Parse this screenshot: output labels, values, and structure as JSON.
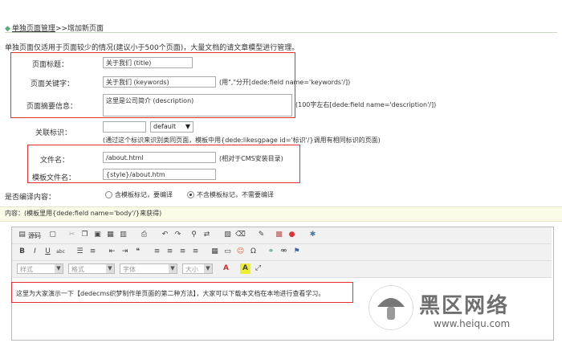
{
  "breadcrumb": {
    "section": "单独页面管理",
    "separator": ">>",
    "current": "增加新页面"
  },
  "note": "单独页面仅适用于页面较少的情况(建议小于500个页面)，大量文档的请文章模型进行管理。",
  "form": {
    "title": {
      "label": "页面标题：",
      "value": "关于我们 (title)"
    },
    "keywords": {
      "label": "页面关键字：",
      "value": "关于我们 (keywords)",
      "hint": "(用\",\"分开[dede:field name='keywords'/])"
    },
    "description": {
      "label": "页面摘要信息：",
      "value": "这里是公司简介 (description)",
      "hint": "(100字左右[dede:field name='description'/])"
    },
    "tag": {
      "label": "关联标识：",
      "select": "default",
      "hint": "(通过这个标识来识别类同页面，模板中用{dede:likesgpage id='标识'/}调用有相同标识的页面)"
    },
    "filename": {
      "label": "文件名：",
      "value": "/about.html",
      "hint": "(相对于CMS安装目录)"
    },
    "template": {
      "label": "模板文件名：",
      "value": "{style}/about.htm"
    },
    "compile": {
      "label": "是否编译内容：",
      "option1": "含模板标记，要编译",
      "option2": "不含模板标记，不需要编译"
    }
  },
  "content_label": "内容：(模板里用{dede:field name='body'/}来获得)",
  "editor": {
    "source_label": "源码",
    "style_placeholder": "样式",
    "format_placeholder": "格式",
    "font_placeholder": "字体",
    "size_placeholder": "大小",
    "body_text": "这里为大家演示一下【dedecms织梦制作单页面的第二种方法】，大家可以下载本文档在本地进行查看学习。"
  },
  "watermark": {
    "name": "黑区网络",
    "url": "www.heiqu.com"
  },
  "colors": {
    "highlight_box": "#e03030",
    "content_bar": "#fbfbe8"
  }
}
